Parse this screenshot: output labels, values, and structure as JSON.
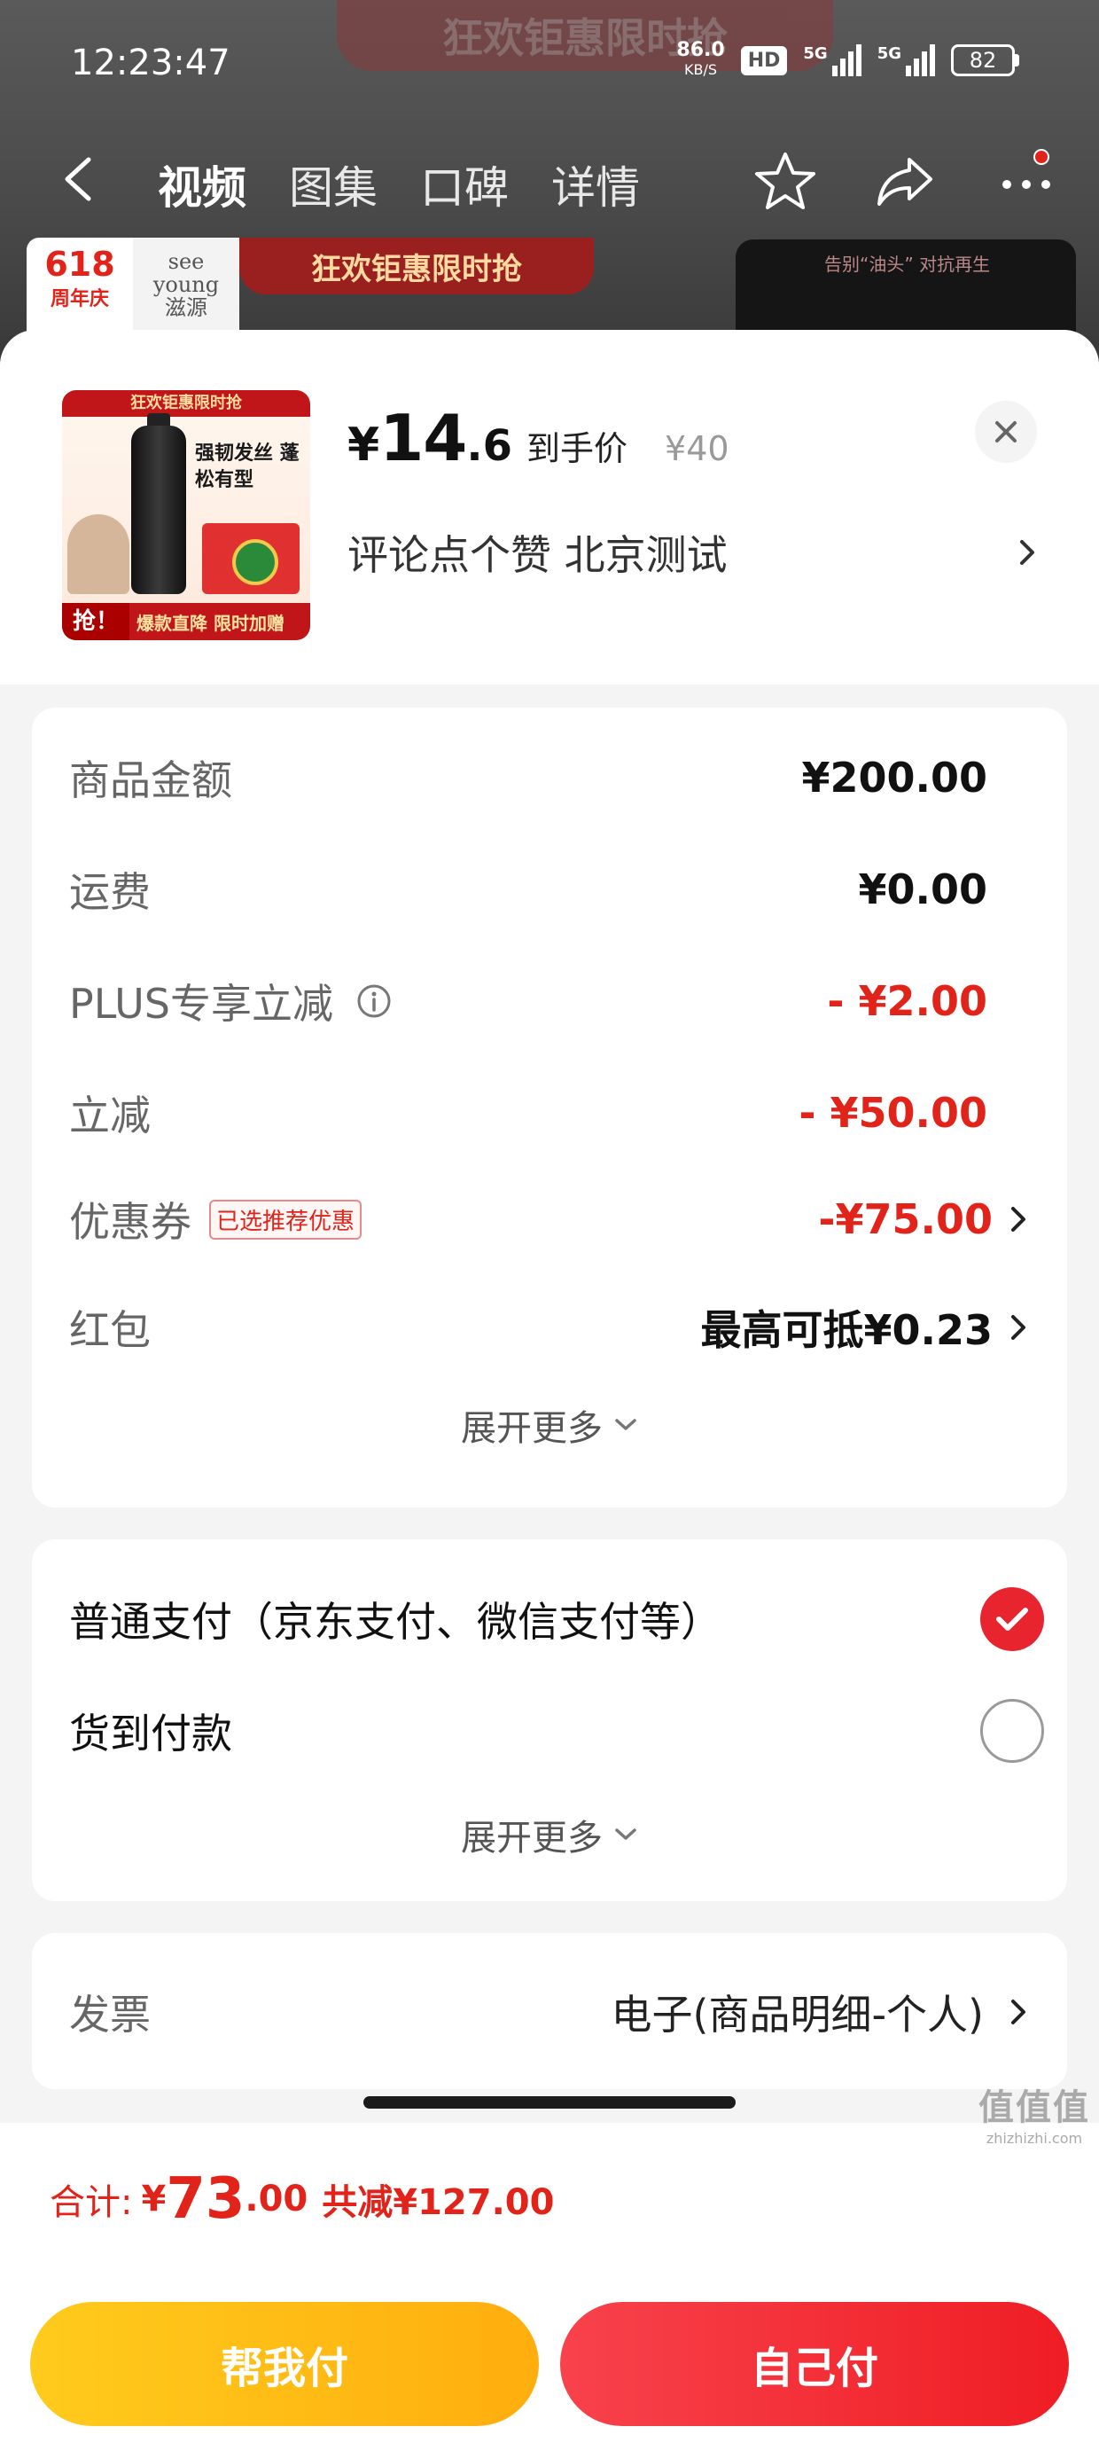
{
  "status_bar": {
    "time": "12:23:47",
    "net_speed": "86.0",
    "net_unit": "KB/S",
    "hd": "HD",
    "sig1_label": "5G",
    "sig2_label": "5G",
    "battery": "82"
  },
  "background": {
    "banner_ghost": "狂欢钜惠限时抢",
    "nav_tabs": [
      "视频",
      "图集",
      "口碑",
      "详情"
    ],
    "promo_618": "618",
    "promo_618_sub": "周年庆",
    "brand_en": "see young",
    "brand_cn": "滋源",
    "sale_text": "狂欢钜惠限时抢",
    "thumb_text": "告别“油头” 对抗再生"
  },
  "product": {
    "image_top_band": "狂欢钜惠限时抢",
    "image_title": "强韧发丝 蓬松有型",
    "image_grab": "抢！",
    "image_slogan": "爆款直降 限时加赠",
    "price_symbol": "¥",
    "price_int": "14",
    "price_dec": ".6",
    "price_label": "到手价",
    "original_price": "¥40",
    "spec_text": "评论点个赞  北京测试"
  },
  "fees": [
    {
      "label": "商品金额",
      "value": "¥200.00",
      "color": "#111111"
    },
    {
      "label": "运费",
      "value": "¥0.00",
      "color": "#111111"
    },
    {
      "label": "PLUS专享立减",
      "value": "- ¥2.00",
      "color": "#e2231a"
    },
    {
      "label": "立减",
      "value": "- ¥50.00",
      "color": "#e2231a"
    },
    {
      "label": "优惠券",
      "tag": "已选推荐优惠",
      "value": "-¥75.00",
      "color": "#e2231a"
    },
    {
      "label": "红包",
      "value": "最高可抵¥0.23",
      "color": "#222222"
    }
  ],
  "fees_expand": "展开更多",
  "payment": {
    "options": [
      {
        "label": "普通支付（京东支付、微信支付等）",
        "selected": true
      },
      {
        "label": "货到付款",
        "selected": false
      }
    ],
    "expand": "展开更多"
  },
  "invoice": {
    "label": "发票",
    "value": "电子(商品明细-个人)"
  },
  "total": {
    "label": "合计:",
    "symbol": "¥",
    "int": "73",
    "dec": ".00",
    "saved": "共减¥127.00"
  },
  "actions": {
    "help_pay": "帮我付",
    "self_pay": "自己付"
  },
  "watermark": {
    "big": "值值值",
    "small": "zhizhizhi.com"
  },
  "colors": {
    "accent_red": "#e2231a",
    "yellow_btn": "#ffb614",
    "red_btn": "#f1262e"
  }
}
